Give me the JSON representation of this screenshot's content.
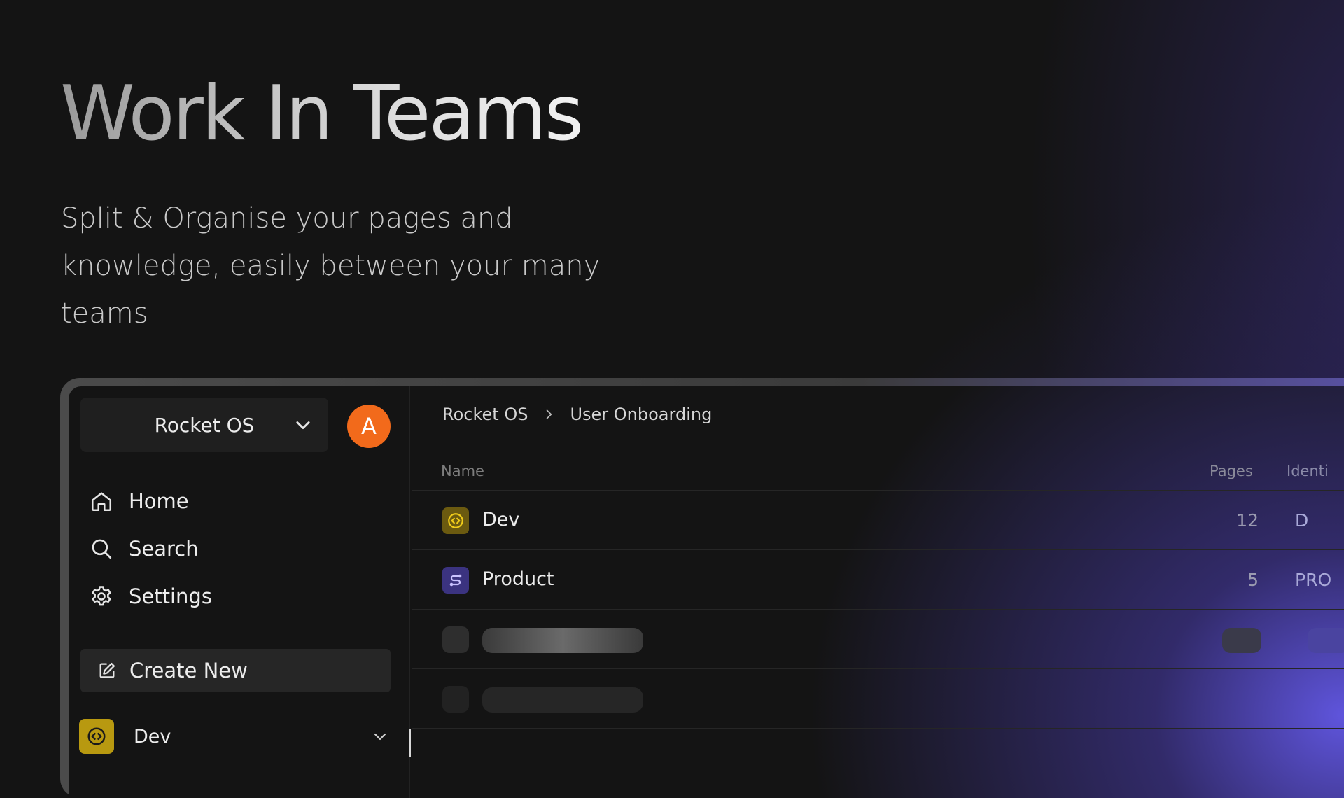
{
  "hero": {
    "headline": "Work In Teams",
    "subheadline": "Split & Organise your pages and knowledge, easily between your many teams"
  },
  "sidebar": {
    "workspace_name": "Rocket OS",
    "avatar_initial": "A",
    "nav_items": [
      {
        "label": "Home",
        "icon": "home-icon"
      },
      {
        "label": "Search",
        "icon": "search-icon"
      },
      {
        "label": "Settings",
        "icon": "gear-icon"
      }
    ],
    "create_new_label": "Create New",
    "team": {
      "label": "Dev",
      "icon": "code-icon"
    }
  },
  "main": {
    "breadcrumb": [
      "Rocket OS",
      "User Onboarding"
    ],
    "table": {
      "columns": [
        "Name",
        "Pages",
        "Identi"
      ],
      "rows": [
        {
          "name": "Dev",
          "pages": "12",
          "identifier": "D",
          "icon": "code-icon",
          "icon_color": "#b89910"
        },
        {
          "name": "Product",
          "pages": "5",
          "identifier": "PRO",
          "icon": "product-icon",
          "icon_color": "#5b4bd6"
        }
      ]
    }
  },
  "colors": {
    "background": "#141414",
    "accent_purple": "#6c60ff",
    "avatar_orange": "#f26a1b",
    "dev_yellow": "#b89910"
  }
}
